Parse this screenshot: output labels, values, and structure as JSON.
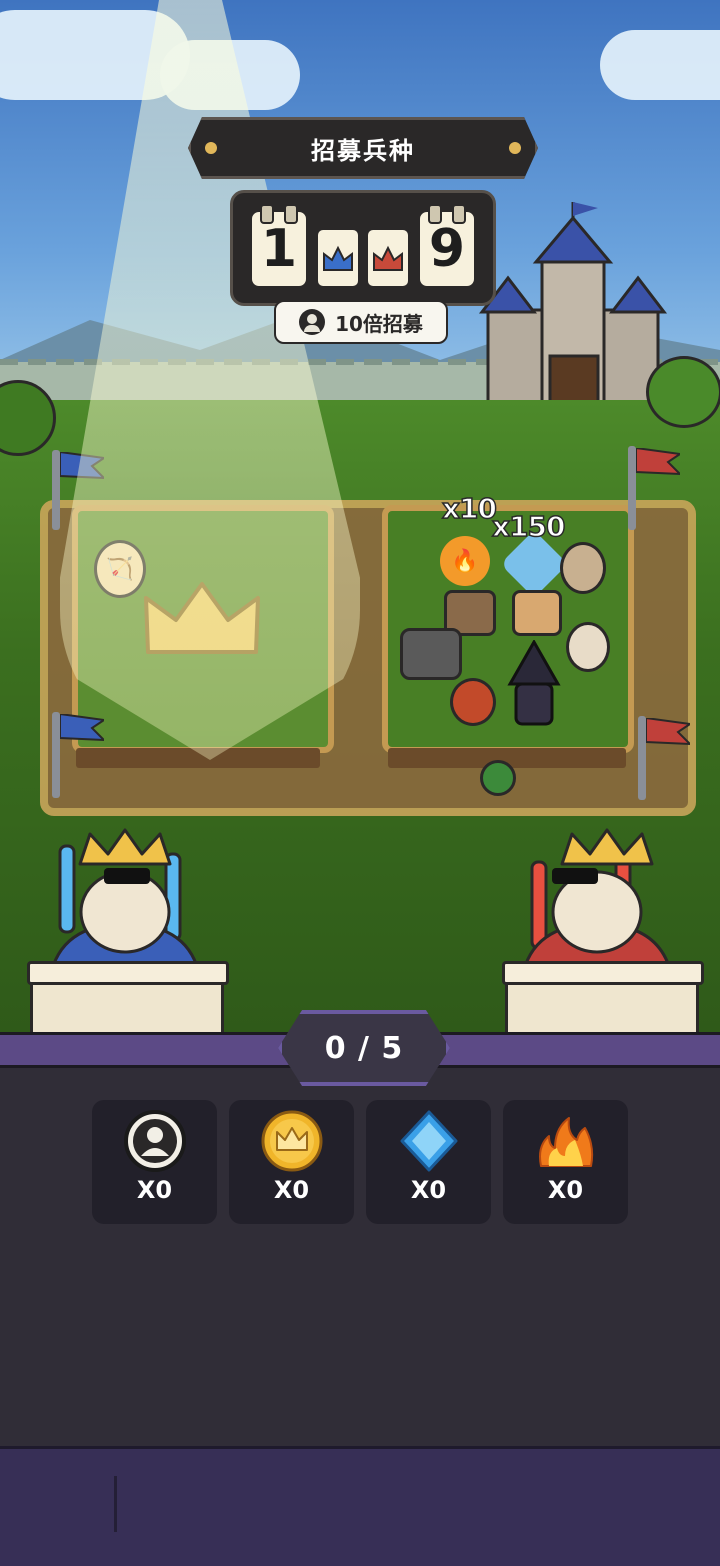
{
  "title": "招募兵种",
  "counter": {
    "left_digit": "1",
    "right_digit": "9"
  },
  "recruit_button": {
    "label": "10倍招募"
  },
  "multipliers": {
    "fire": "x10",
    "gem": "x150"
  },
  "progress": {
    "text": "0 / 5",
    "current": 0,
    "total": 5
  },
  "resources": [
    {
      "name": "avatar-token",
      "count": "X0"
    },
    {
      "name": "crown-coin",
      "count": "X0"
    },
    {
      "name": "blue-gem",
      "count": "X0"
    },
    {
      "name": "fire",
      "count": "X0"
    }
  ],
  "colors": {
    "team_left": "#3a5fb8",
    "team_right": "#c0403a",
    "accent_purple": "#6a5aa0"
  }
}
